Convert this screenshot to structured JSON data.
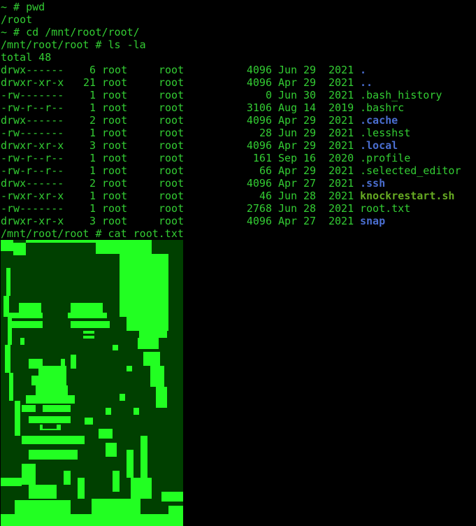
{
  "colors": {
    "background": "#000000",
    "text": "#33cc33",
    "directory": "#4a6ed0",
    "executable": "#66aa22",
    "art_dark": "#004000",
    "art_bright": "#22ff22"
  },
  "commands": [
    {
      "prompt": "~ # ",
      "command": "pwd"
    },
    {
      "output": "/root"
    },
    {
      "prompt": "~ # ",
      "command": "cd /mnt/root/root/"
    },
    {
      "prompt": "/mnt/root/root # ",
      "command": "ls -la"
    },
    {
      "output": "total 48"
    }
  ],
  "listing": [
    {
      "perm": "drwx------",
      "links": "6",
      "owner": "root",
      "group": "root",
      "size": "4096",
      "month": "Jun",
      "day": "29",
      "year": "2021",
      "name": ".",
      "type": "dir"
    },
    {
      "perm": "drwxr-xr-x",
      "links": "21",
      "owner": "root",
      "group": "root",
      "size": "4096",
      "month": "Apr",
      "day": "29",
      "year": "2021",
      "name": "..",
      "type": "dir"
    },
    {
      "perm": "-rw-------",
      "links": "1",
      "owner": "root",
      "group": "root",
      "size": "0",
      "month": "Jun",
      "day": "30",
      "year": "2021",
      "name": ".bash_history",
      "type": "file"
    },
    {
      "perm": "-rw-r--r--",
      "links": "1",
      "owner": "root",
      "group": "root",
      "size": "3106",
      "month": "Aug",
      "day": "14",
      "year": "2019",
      "name": ".bashrc",
      "type": "file"
    },
    {
      "perm": "drwx------",
      "links": "2",
      "owner": "root",
      "group": "root",
      "size": "4096",
      "month": "Apr",
      "day": "29",
      "year": "2021",
      "name": ".cache",
      "type": "dir"
    },
    {
      "perm": "-rw-------",
      "links": "1",
      "owner": "root",
      "group": "root",
      "size": "28",
      "month": "Jun",
      "day": "29",
      "year": "2021",
      "name": ".lesshst",
      "type": "file"
    },
    {
      "perm": "drwxr-xr-x",
      "links": "3",
      "owner": "root",
      "group": "root",
      "size": "4096",
      "month": "Apr",
      "day": "29",
      "year": "2021",
      "name": ".local",
      "type": "dir"
    },
    {
      "perm": "-rw-r--r--",
      "links": "1",
      "owner": "root",
      "group": "root",
      "size": "161",
      "month": "Sep",
      "day": "16",
      "year": "2020",
      "name": ".profile",
      "type": "file"
    },
    {
      "perm": "-rw-r--r--",
      "links": "1",
      "owner": "root",
      "group": "root",
      "size": "66",
      "month": "Apr",
      "day": "29",
      "year": "2021",
      "name": ".selected_editor",
      "type": "file"
    },
    {
      "perm": "drwx------",
      "links": "2",
      "owner": "root",
      "group": "root",
      "size": "4096",
      "month": "Apr",
      "day": "27",
      "year": "2021",
      "name": ".ssh",
      "type": "dir"
    },
    {
      "perm": "-rwxr-xr-x",
      "links": "1",
      "owner": "root",
      "group": "root",
      "size": "46",
      "month": "Jun",
      "day": "28",
      "year": "2021",
      "name": "knockrestart.sh",
      "type": "exe"
    },
    {
      "perm": "-rw-------",
      "links": "1",
      "owner": "root",
      "group": "root",
      "size": "2768",
      "month": "Jun",
      "day": "28",
      "year": "2021",
      "name": "root.txt",
      "type": "file"
    },
    {
      "perm": "drwxr-xr-x",
      "links": "3",
      "owner": "root",
      "group": "root",
      "size": "4096",
      "month": "Apr",
      "day": "27",
      "year": "2021",
      "name": "snap",
      "type": "dir"
    }
  ],
  "last_command": {
    "prompt": "/mnt/root/root # ",
    "command": "cat root.txt"
  },
  "art": {
    "icon": "ascii-portrait-art"
  }
}
